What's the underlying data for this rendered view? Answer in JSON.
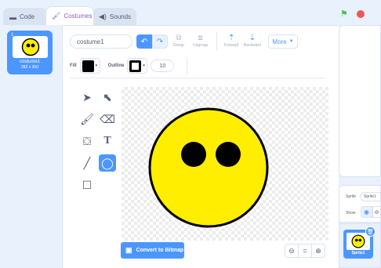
{
  "tabs": [
    {
      "label": "Code",
      "icon": "code-icon"
    },
    {
      "label": "Costumes",
      "icon": "brush-icon"
    },
    {
      "label": "Sounds",
      "icon": "speaker-icon"
    }
  ],
  "costume_list": {
    "items": [
      {
        "number": "1",
        "name": "costume1",
        "size": "282 x 300"
      }
    ]
  },
  "toolbar": {
    "costume_name": "costume1",
    "undo_icon": "undo-icon",
    "redo_icon": "redo-icon",
    "group_label": "Group",
    "ungroup_label": "Ungroup",
    "forward_label": "Forward",
    "backward_label": "Backward",
    "more_label": "More"
  },
  "properties": {
    "fill_label": "Fill",
    "fill_color": "#000000",
    "outline_label": "Outline",
    "outline_color": "#000000",
    "outline_width": "10"
  },
  "tools": [
    {
      "name": "select-tool",
      "icon": "arrow-icon",
      "active": false
    },
    {
      "name": "reshape-tool",
      "icon": "reshape-icon",
      "active": false
    },
    {
      "name": "brush-tool",
      "icon": "brush-icon",
      "active": false
    },
    {
      "name": "eraser-tool",
      "icon": "eraser-icon",
      "active": false
    },
    {
      "name": "fill-tool",
      "icon": "bucket-icon",
      "active": false
    },
    {
      "name": "text-tool",
      "icon": "text-icon",
      "active": false
    },
    {
      "name": "line-tool",
      "icon": "line-icon",
      "active": false
    },
    {
      "name": "circle-tool",
      "icon": "circle-icon",
      "active": true
    },
    {
      "name": "rectangle-tool",
      "icon": "rectangle-icon",
      "active": false
    }
  ],
  "canvas": {
    "face_color": "#ffee00",
    "outline_color": "#000000"
  },
  "convert_button": {
    "label": "Convert to Bitmap",
    "icon": "bitmap-icon"
  },
  "zoom": {
    "zoom_out": "zoom-out-icon",
    "reset": "=",
    "zoom_in": "zoom-in-icon"
  },
  "sprite_info": {
    "sprite_label": "Sprite",
    "sprite_name": "Sprite1",
    "show_label": "Show"
  },
  "sprites": [
    {
      "name": "Sprite1"
    }
  ],
  "colors": {
    "accent": "#4c97ff",
    "flag": "#4cbf56",
    "stop": "#ec5959"
  }
}
